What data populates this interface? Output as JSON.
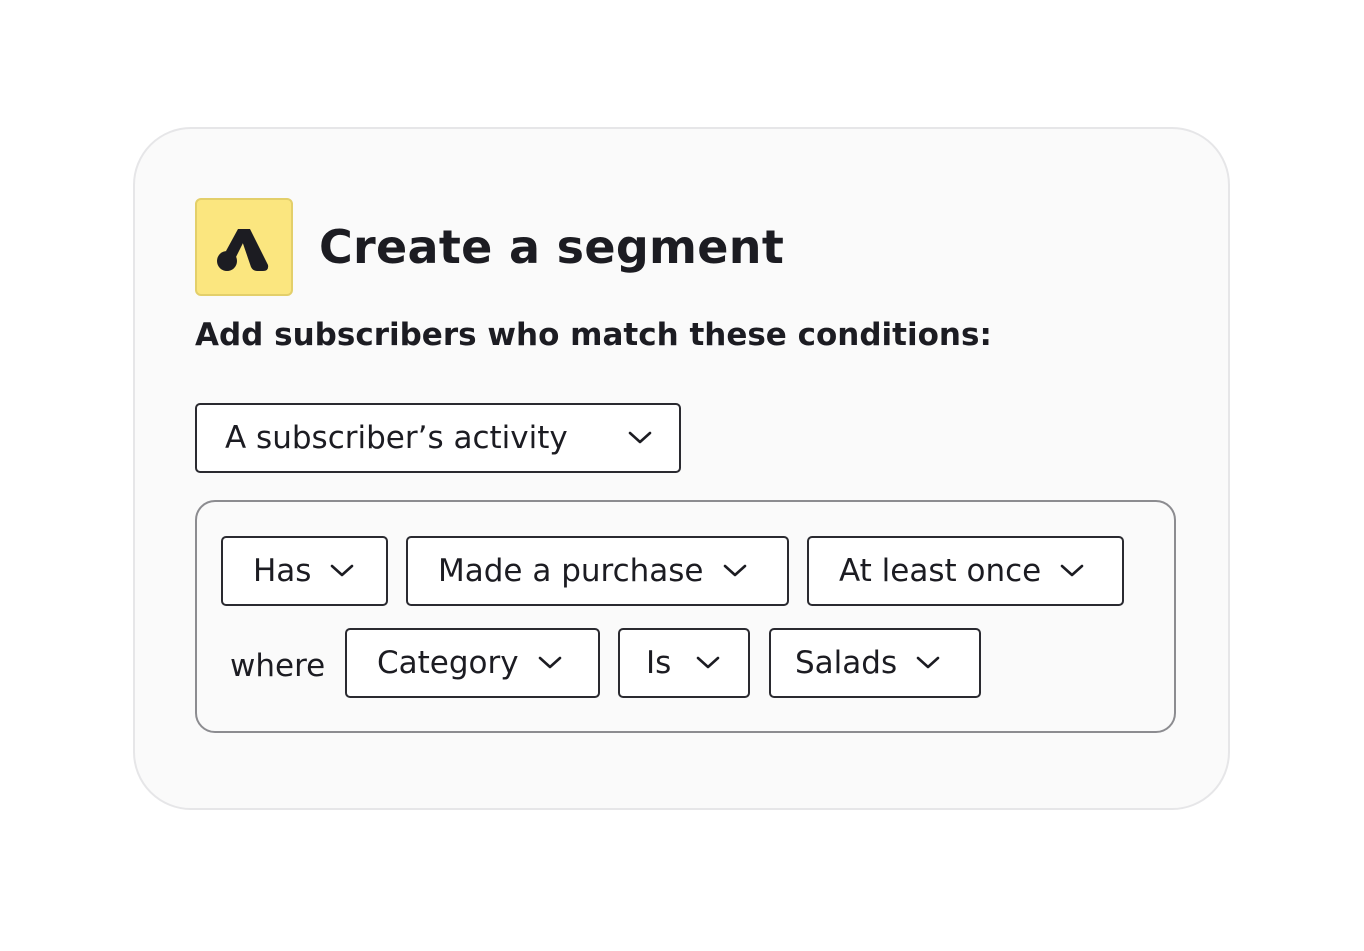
{
  "card": {
    "title": "Create a segment",
    "subtitle": "Add subscribers who match these conditions:",
    "logo_icon": "brand-a-logo-icon",
    "colors": {
      "logo_bg": "#fbe67f",
      "text": "#1c1c22",
      "card_bg": "#fafafa"
    }
  },
  "primary_select": {
    "value": "A subscriber’s activity"
  },
  "conditions": {
    "row1": [
      {
        "value": "Has"
      },
      {
        "value": "Made a purchase"
      },
      {
        "value": "At least once"
      }
    ],
    "where_label": "where",
    "row2": [
      {
        "value": "Category"
      },
      {
        "value": "Is"
      },
      {
        "value": "Salads"
      }
    ]
  }
}
